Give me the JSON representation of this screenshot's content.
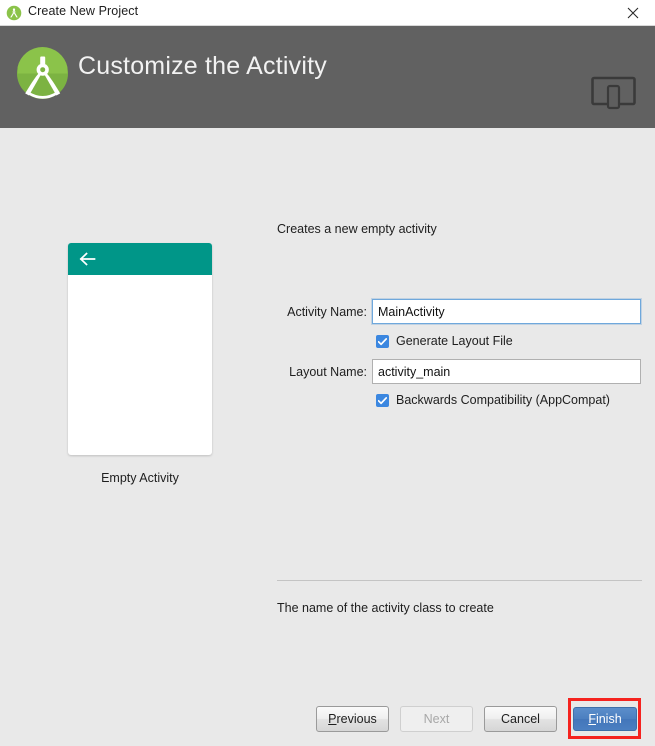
{
  "window": {
    "title": "Create New Project",
    "icon": "android-studio-icon",
    "close_label": "✕"
  },
  "header": {
    "title": "Customize the Activity",
    "logo_icon": "android-studio-logo",
    "device_icon": "device-preview-icon",
    "background_color": "#616161"
  },
  "preview": {
    "back_icon": "back-arrow-icon",
    "appbar_color": "#009688",
    "label": "Empty Activity"
  },
  "form": {
    "description": "Creates a new empty activity",
    "activity_name": {
      "label": "Activity Name:",
      "value": "MainActivity",
      "placeholder": "MainActivity"
    },
    "generate_layout_file": {
      "label": "Generate Layout File",
      "checked": true
    },
    "layout_name": {
      "label": "Layout Name:",
      "value": "activity_main",
      "placeholder": "activity_main"
    },
    "backwards_compatibility": {
      "label": "Backwards Compatibility (AppCompat)",
      "checked": true
    },
    "hint": "The name of the activity class to create"
  },
  "buttons": {
    "previous": {
      "mnemonic": "P",
      "rest": "revious"
    },
    "next": {
      "label": "Next"
    },
    "cancel": {
      "label": "Cancel"
    },
    "finish": {
      "mnemonic": "F",
      "rest": "inish"
    }
  },
  "colors": {
    "accent_blue": "#4c7fc0",
    "checkbox_blue": "#3b87e0",
    "teal": "#009688",
    "highlight_red": "#f5231f",
    "dialog_bg": "#e9e9e9"
  }
}
